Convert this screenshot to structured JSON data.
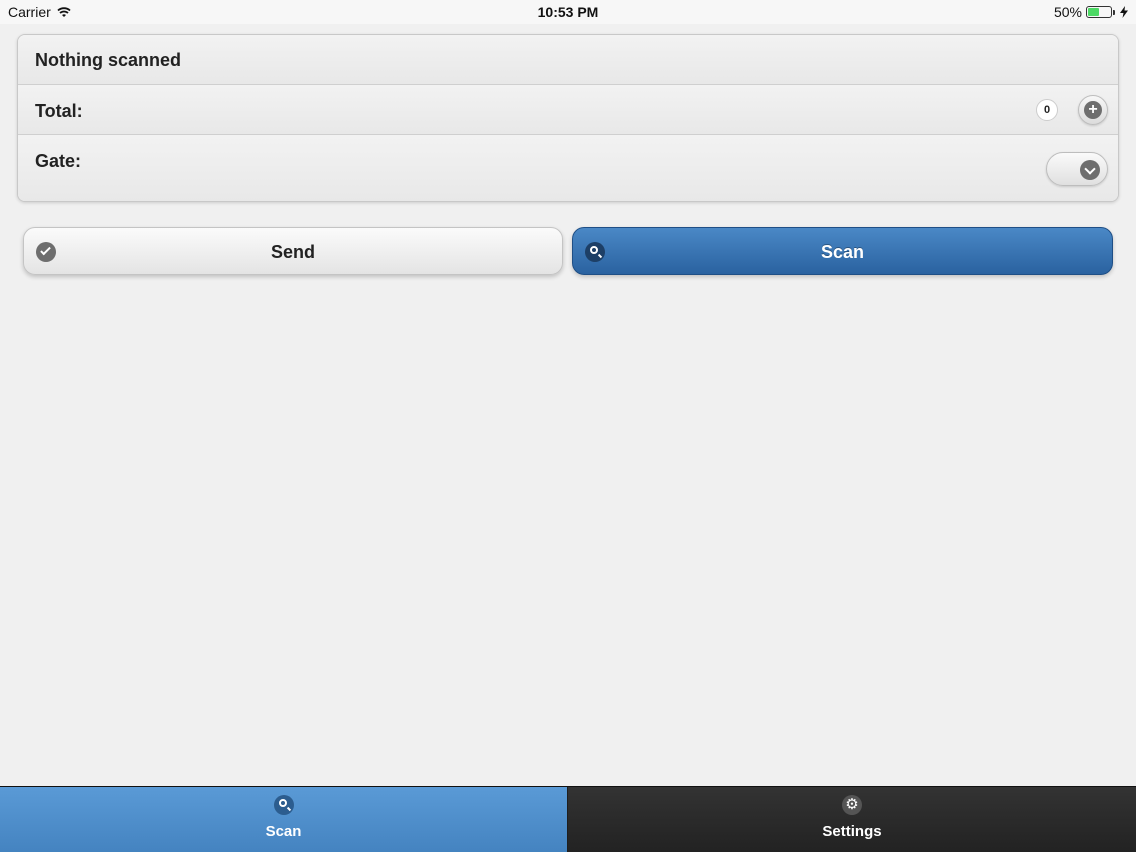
{
  "status_bar": {
    "carrier": "Carrier",
    "time": "10:53 PM",
    "battery_percent": "50%",
    "battery_level": 0.5
  },
  "panel": {
    "title": "Nothing scanned",
    "total_label": "Total:",
    "total_count": "0",
    "gate_label": "Gate:"
  },
  "actions": {
    "send_label": "Send",
    "scan_label": "Scan"
  },
  "tabbar": {
    "scan_label": "Scan",
    "settings_label": "Settings",
    "active_tab": "Scan"
  },
  "colors": {
    "accent": "#2a62a0",
    "tab_active": "#4a8ac8",
    "tab_inactive": "#2b2b2b",
    "battery": "#4cd964"
  }
}
